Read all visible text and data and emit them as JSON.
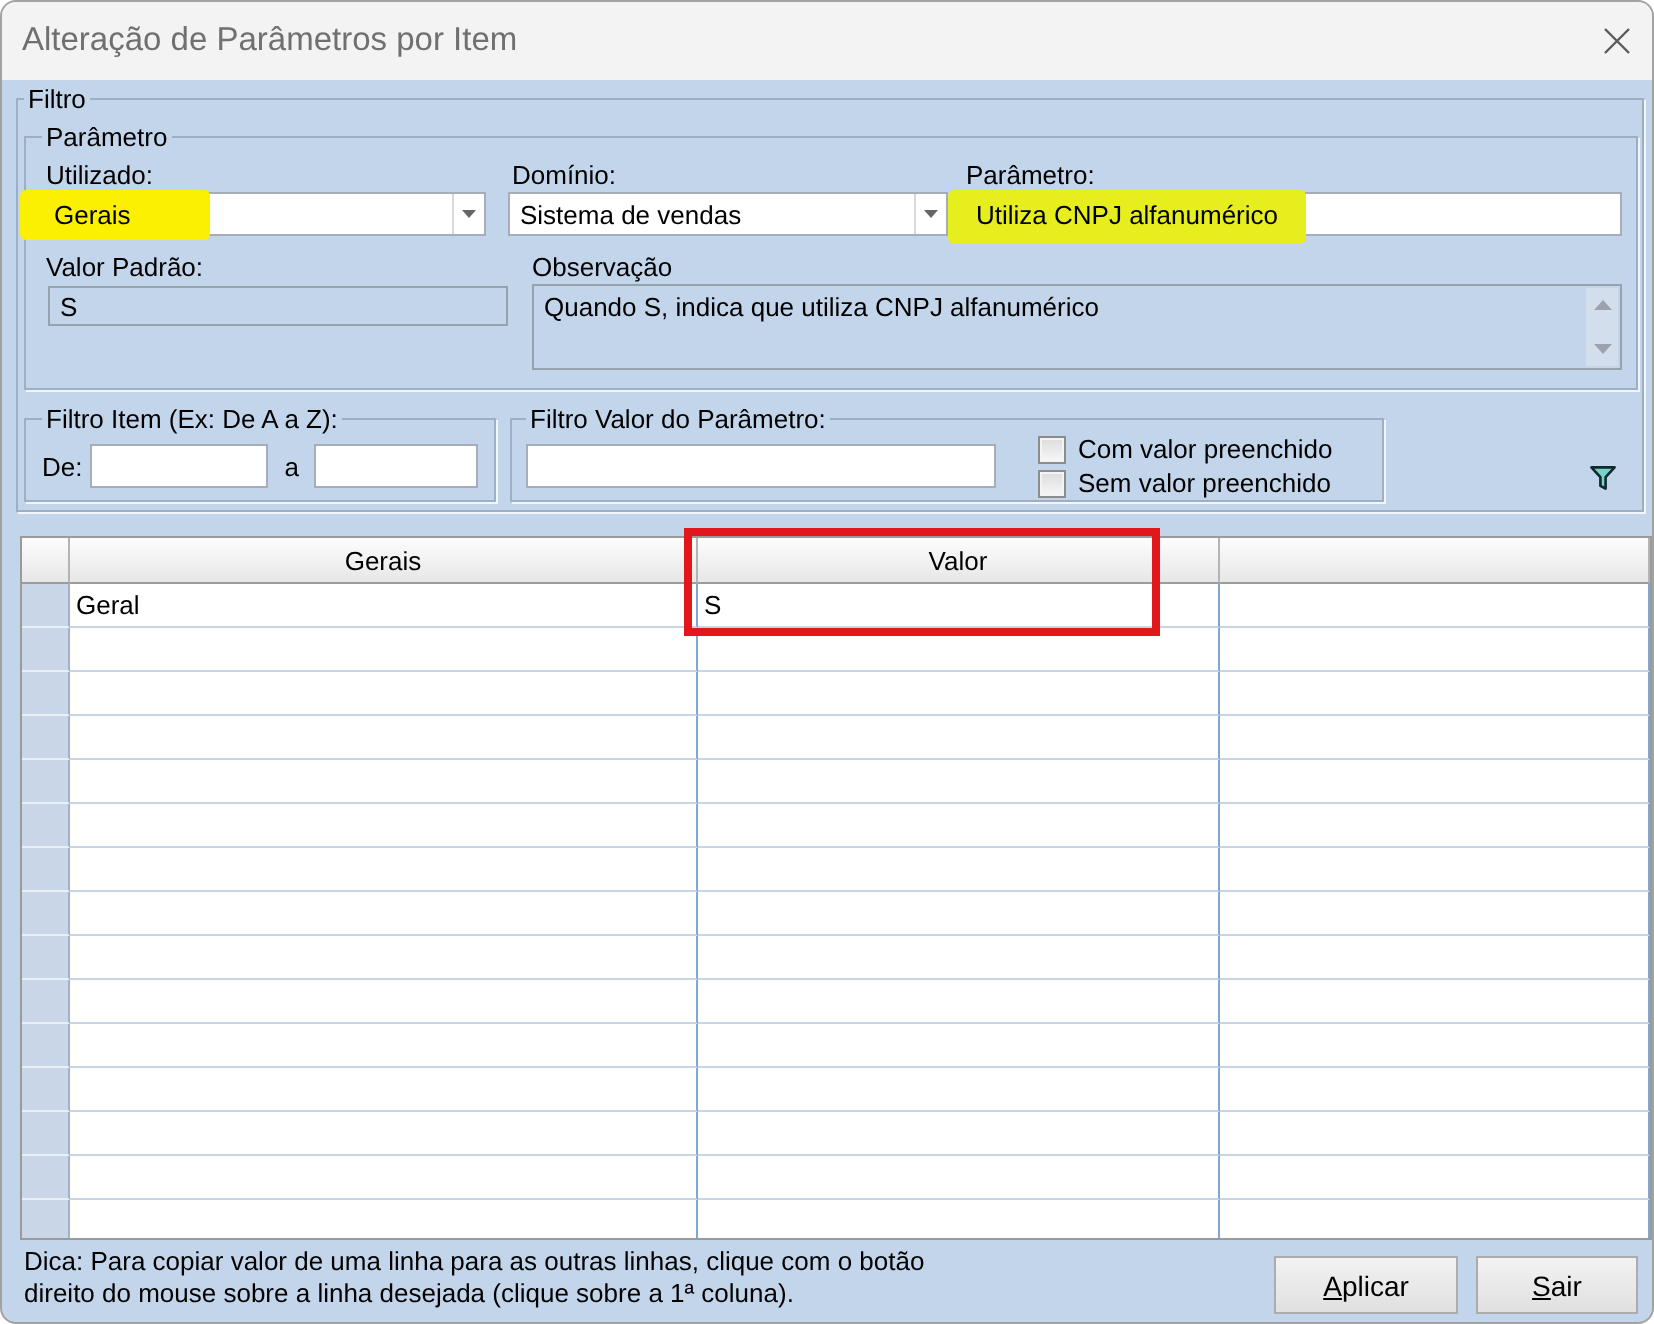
{
  "window": {
    "title": "Alteração de Parâmetros por Item"
  },
  "filter": {
    "title": "Filtro",
    "parameter_group": {
      "title": "Parâmetro",
      "rows": [
        {
          "fields": [
            {
              "kind": "dropdown",
              "label": "Utilizado:",
              "value": "Gerais",
              "highlighted": true
            },
            {
              "kind": "dropdown",
              "label": "Domínio:",
              "value": "Sistema de vendas",
              "highlighted": false
            },
            {
              "kind": "text",
              "label": "Parâmetro:",
              "value": "Utiliza CNPJ alfanumérico",
              "highlighted": true
            }
          ]
        },
        {
          "fields": [
            {
              "kind": "readonly",
              "label": "Valor Padrão:",
              "value": "S",
              "highlighted": false
            },
            {
              "kind": "memo",
              "label": "Observação",
              "value": "Quando S, indica que utiliza CNPJ alfanumérico",
              "highlighted": false
            }
          ]
        }
      ]
    },
    "item_filter": {
      "title": "Filtro Item (Ex: De A a Z):",
      "from_label": "De:",
      "to_label": "a"
    },
    "value_filter": {
      "title": "Filtro Valor do Parâmetro:",
      "options": [
        {
          "label": "Com valor preenchido",
          "checked": false
        },
        {
          "label": "Sem valor preenchido",
          "checked": false
        }
      ]
    }
  },
  "grid": {
    "columns": [
      {
        "title": "Gerais",
        "outlined": false
      },
      {
        "title": "Valor",
        "outlined": true
      }
    ],
    "rows": [
      {
        "cells": [
          "Geral",
          "S"
        ]
      }
    ]
  },
  "footer": {
    "hint": "Dica: Para copiar valor de uma linha para as outras linhas, clique com o botão direito do mouse sobre a linha desejada (clique sobre a 1ª coluna).",
    "buttons": [
      {
        "label": "Aplicar",
        "underline_first": true
      },
      {
        "label": "Sair",
        "underline_first": true
      }
    ]
  }
}
